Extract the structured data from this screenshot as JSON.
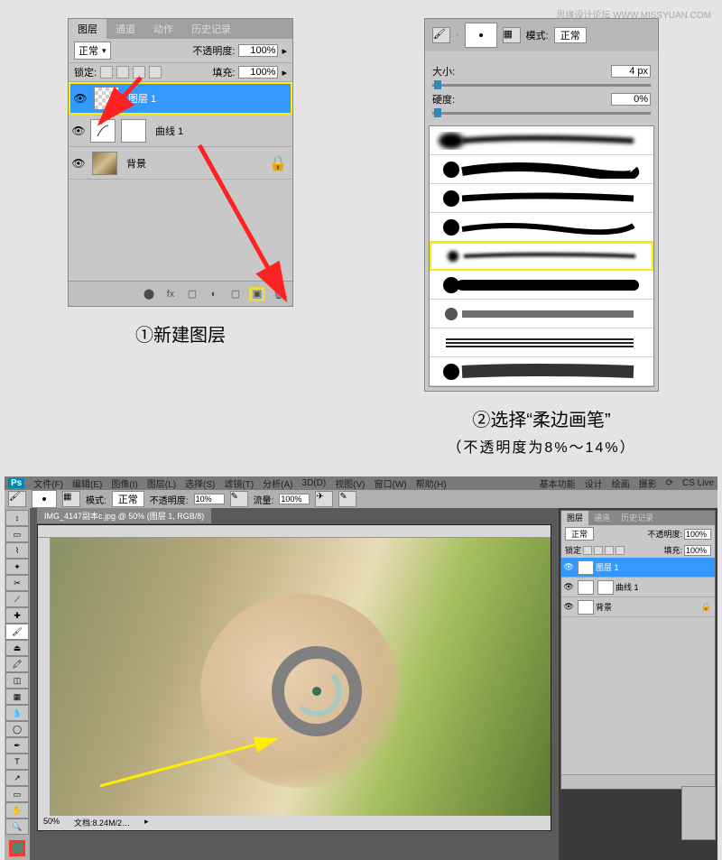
{
  "watermark": "思缘设计论坛  WWW.MISSYUAN.COM",
  "layers_panel": {
    "tabs": [
      "图层",
      "通道",
      "动作",
      "历史记录"
    ],
    "blend_mode": "正常",
    "opacity_label": "不透明度:",
    "opacity_value": "100%",
    "lock_label": "锁定:",
    "fill_label": "填充:",
    "fill_value": "100%",
    "layers": [
      {
        "name": "图层 1",
        "selected": true
      },
      {
        "name": "曲线 1",
        "selected": false
      },
      {
        "name": "背景",
        "selected": false
      }
    ]
  },
  "brush_panel": {
    "mode_label": "模式:",
    "mode_value": "正常",
    "size_label": "大小:",
    "size_value": "4 px",
    "hardness_label": "硬度:",
    "hardness_value": "0%",
    "brush_size_num": "4"
  },
  "captions": {
    "step1": "①新建图层",
    "step2": "②选择“柔边画笔”",
    "step2_sub": "（不透明度为8%～14%）"
  },
  "ps_window": {
    "menubar": [
      "文件(F)",
      "编辑(E)",
      "图像(I)",
      "图层(L)",
      "选择(S)",
      "滤镜(T)",
      "分析(A)",
      "3D(D)",
      "视图(V)",
      "窗口(W)",
      "帮助(H)"
    ],
    "menubar_right": [
      "基本功能",
      "设计",
      "绘画",
      "摄影",
      "CS Live"
    ],
    "optionbar": {
      "mode_label": "模式:",
      "mode_value": "正常",
      "opacity_label": "不透明度:",
      "opacity_value": "10%",
      "flow_label": "流量:",
      "flow_value": "100%"
    },
    "doc_tab": "IMG_4147副本c.jpg @ 50% (图层 1, RGB/8)",
    "status_zoom": "50%",
    "status_doc": "文档:8.24M/2…",
    "right_panel": {
      "tabs": [
        "图层",
        "通道",
        "历史记录"
      ],
      "blend_mode": "正常",
      "opacity_label": "不透明度:",
      "opacity_value": "100%",
      "lock_label": "锁定",
      "fill_label": "填充:",
      "fill_value": "100%",
      "layers": [
        {
          "name": "图层 1",
          "selected": true
        },
        {
          "name": "曲线 1",
          "selected": false
        },
        {
          "name": "背景",
          "selected": false
        }
      ]
    }
  }
}
